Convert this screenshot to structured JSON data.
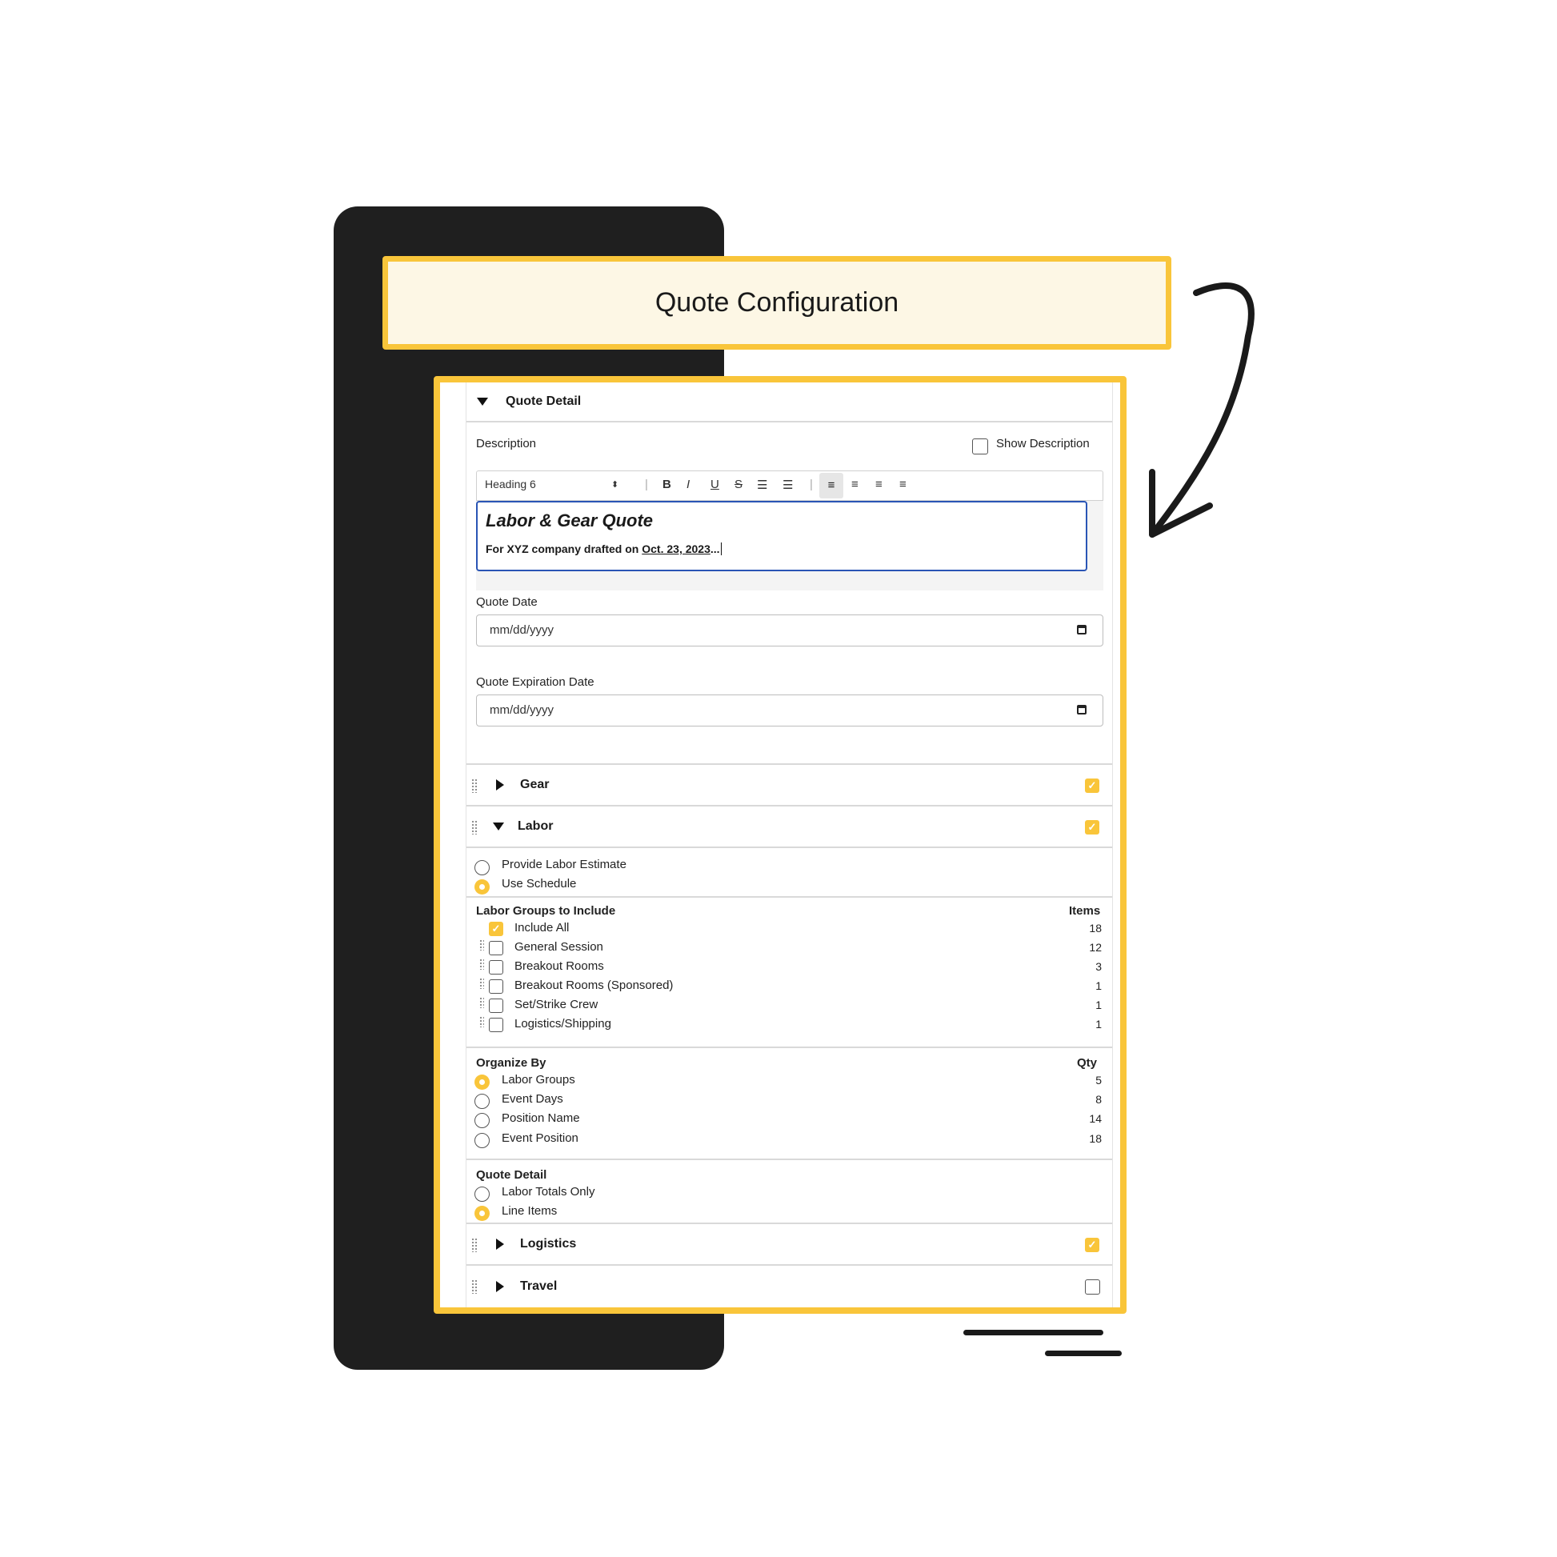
{
  "banner": {
    "title": "Quote Configuration"
  },
  "quote_detail": {
    "header": "Quote Detail",
    "description_label": "Description",
    "show_description_label": "Show Description",
    "toolbar": {
      "block_style": "Heading 6",
      "bold": "B",
      "italic": "I",
      "underline": "U",
      "strike": "S"
    },
    "editor": {
      "heading": "Labor & Gear Quote",
      "line_prefix": "For XYZ company drafted on ",
      "line_date": "Oct. 23, 2023",
      "line_suffix": "..."
    },
    "quote_date_label": "Quote Date",
    "quote_date_placeholder": "mm/dd/yyyy",
    "expiration_label": "Quote Expiration Date",
    "expiration_placeholder": "mm/dd/yyyy"
  },
  "sections": {
    "gear": {
      "label": "Gear",
      "checked": true
    },
    "labor": {
      "label": "Labor",
      "checked": true
    },
    "logistics": {
      "label": "Logistics",
      "checked": true
    },
    "travel": {
      "label": "Travel",
      "checked": false
    }
  },
  "labor": {
    "estimate_options": [
      {
        "label": "Provide Labor Estimate",
        "selected": false
      },
      {
        "label": "Use Schedule",
        "selected": true
      }
    ],
    "groups_title": "Labor Groups to Include",
    "groups_count_header": "Items",
    "groups": [
      {
        "label": "Include All",
        "count": "18",
        "checked": true
      },
      {
        "label": "General Session",
        "count": "12",
        "checked": false
      },
      {
        "label": "Breakout Rooms",
        "count": "3",
        "checked": false
      },
      {
        "label": "Breakout Rooms (Sponsored)",
        "count": "1",
        "checked": false
      },
      {
        "label": "Set/Strike Crew",
        "count": "1",
        "checked": false
      },
      {
        "label": "Logistics/Shipping",
        "count": "1",
        "checked": false
      }
    ],
    "organize_title": "Organize By",
    "organize_count_header": "Qty",
    "organize": [
      {
        "label": "Labor Groups",
        "count": "5",
        "selected": true
      },
      {
        "label": "Event Days",
        "count": "8",
        "selected": false
      },
      {
        "label": "Position Name",
        "count": "14",
        "selected": false
      },
      {
        "label": "Event Position",
        "count": "18",
        "selected": false
      }
    ],
    "detail_title": "Quote Detail",
    "detail": [
      {
        "label": "Labor Totals Only",
        "selected": false
      },
      {
        "label": "Line Items",
        "selected": true
      }
    ]
  },
  "colors": {
    "accent": "#f9c53a",
    "editor_border": "#2a55b5",
    "dark_panel": "#1f1f1f"
  }
}
